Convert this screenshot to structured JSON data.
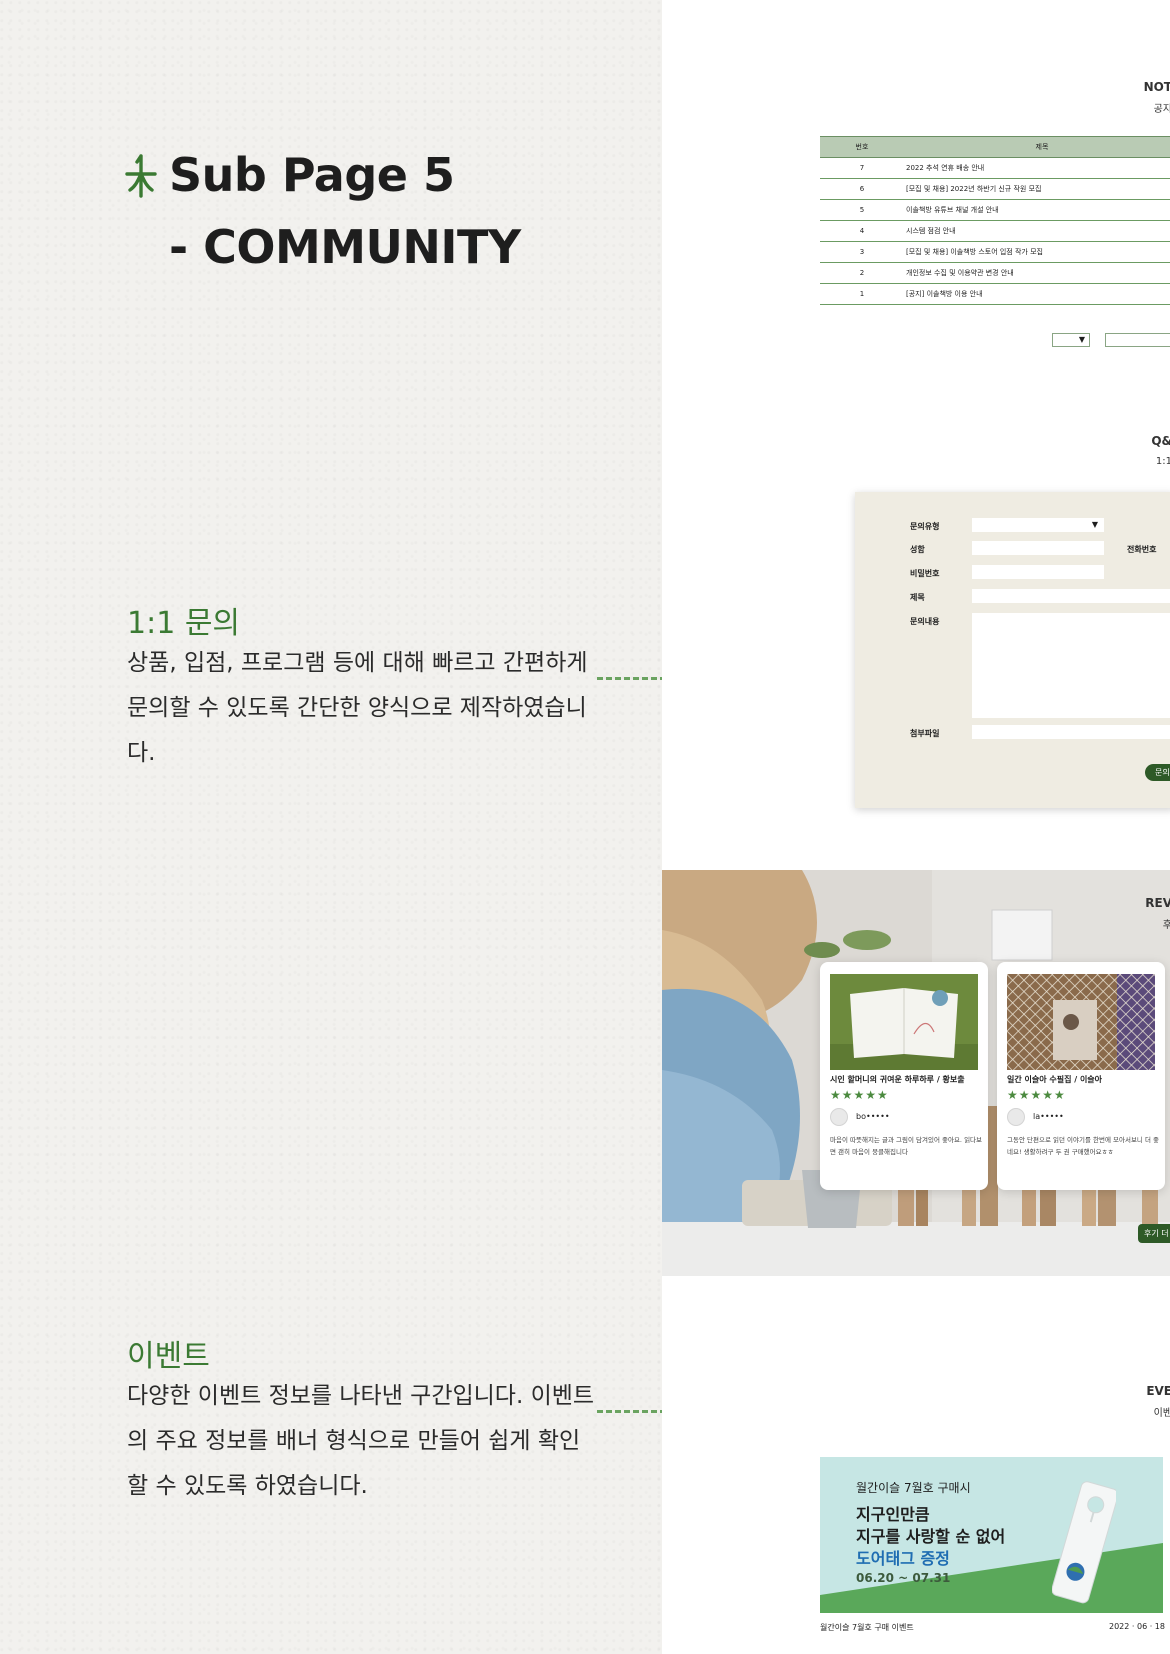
{
  "title": {
    "line1": "Sub Page 5",
    "line2": "- COMMUNITY"
  },
  "sections": {
    "qa": {
      "label": "1:1 문의",
      "desc": "상품, 입점, 프로그램 등에 대해 빠르고 간편하게 문의할 수 있도록 간단한 양식으로 제작하였습니다."
    },
    "event": {
      "label": "이벤트",
      "desc": "다양한 이벤트 정보를 나타낸 구간입니다. 이벤트의 주요 정보를 배너 형식으로 만들어 쉽게 확인할 수 있도록 하였습니다."
    }
  },
  "notice": {
    "heading": "NOT",
    "sub": "공지",
    "columns": [
      "번호",
      "제목"
    ],
    "rows": [
      {
        "num": "7",
        "title": "2022 추석 연휴 배송 안내"
      },
      {
        "num": "6",
        "title": "[모집 및 채용] 2022년 하반기 신규 작원 모집"
      },
      {
        "num": "5",
        "title": "이솔책방 유튜브 채널 개설 안내"
      },
      {
        "num": "4",
        "title": "시스템 점검 안내"
      },
      {
        "num": "3",
        "title": "[모집 및 채용] 이솔책방 스토어 입점 작가 모집"
      },
      {
        "num": "2",
        "title": "개인정보 수집 및 이용약관 변경 안내"
      },
      {
        "num": "1",
        "title": "[공지] 이솔책방 이용 안내"
      }
    ],
    "select_arrow": "▼"
  },
  "qa_form": {
    "heading": "Q&",
    "sub": "1:1",
    "labels": {
      "type": "문의유형",
      "name": "성함",
      "phone": "전화번호",
      "password": "비밀번호",
      "subject": "제목",
      "content": "문의내용",
      "attach": "첨부파일"
    },
    "select_arrow": "▼",
    "submit": "문의"
  },
  "review": {
    "heading": "REV",
    "sub": "후",
    "cards": [
      {
        "title": "시인 할머니의 귀여운 하루하루 / 황보출",
        "stars": "★★★★★",
        "user": "bo•••••",
        "text": "마음이 따뜻해지는 글과 그림이 담겨있어 좋아요. 읽다보면 괜히 마음이 뭉클해집니다"
      },
      {
        "title": "일간 이슬아 수필집 / 이슬아",
        "stars": "★★★★★",
        "user": "la•••••",
        "text": "그동안 단편으로 읽던 이야기를 한번에 모아서보니 더 좋네요! 생활하려구 두 권 구매했어요ㅎㅎ"
      }
    ],
    "more_button": "후기 더"
  },
  "event": {
    "heading": "EVE",
    "sub": "이벤",
    "banner": {
      "line1": "월간이슬 7월호 구매시",
      "line2": "지구인만큼",
      "line3": "지구를 사랑할 순 없어",
      "line4": "도어태그 증정",
      "date": "06.20 ~ 07.31"
    },
    "caption": "월간이슬 7월호 구매 이벤트",
    "date": "2022 · 06 · 18"
  },
  "colors": {
    "accent": "#3b7a33",
    "table_header": "#b9cbb4",
    "form_bg": "#efece2",
    "button": "#2e5a27"
  },
  "icons": {
    "title": "leaf-icon"
  }
}
